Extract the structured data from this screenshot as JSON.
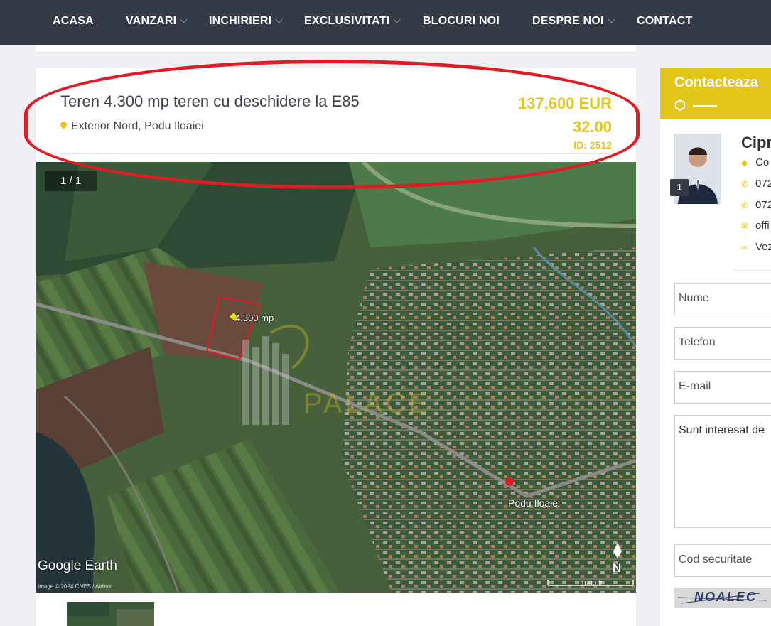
{
  "nav": {
    "items": [
      {
        "label": "ACASA",
        "has_dropdown": false
      },
      {
        "label": "VANZARI",
        "has_dropdown": true
      },
      {
        "label": "INCHIRIERI",
        "has_dropdown": true
      },
      {
        "label": "EXCLUSIVITATI",
        "has_dropdown": true
      },
      {
        "label": "BLOCURI NOI",
        "has_dropdown": false
      },
      {
        "label": "DESPRE NOI",
        "has_dropdown": true
      },
      {
        "label": "CONTACT",
        "has_dropdown": false
      }
    ]
  },
  "listing": {
    "title": "Teren 4.300 mp teren cu deschidere la E85",
    "location": "Exterior Nord, Podu Iloaiei",
    "price": "137,600 EUR",
    "price_per_sqm": "32.00",
    "id_label": "ID: 2512"
  },
  "gallery": {
    "counter": "1 / 1",
    "map_label_area": "4.300 mp",
    "map_label_town": "Podu Iloaiei",
    "watermark": "PALACE",
    "google_earth": "Google Earth",
    "attribution": "Image © 2024 CNES / Airbus",
    "scale": "1000 ft",
    "north": "N"
  },
  "sidebar": {
    "title": "Contacteaza",
    "agent_name": "Cipr",
    "agent_badge": "1",
    "info": [
      {
        "icon": "tag-icon",
        "text": "Co"
      },
      {
        "icon": "phone-icon",
        "text": "072"
      },
      {
        "icon": "phone-icon",
        "text": "072"
      },
      {
        "icon": "envelope-icon",
        "text": "offi"
      },
      {
        "icon": "link-icon",
        "text": "Vez"
      }
    ],
    "form": {
      "name_placeholder": "Nume",
      "phone_placeholder": "Telefon",
      "email_placeholder": "E-mail",
      "message_value": "Sunt interesat de",
      "code_placeholder": "Cod securitate",
      "captcha_text": "NOALEC"
    }
  },
  "colors": {
    "nav_bg": "#343a46",
    "accent_yellow": "#e3c61a",
    "highlight_red": "#e01b24",
    "page_bg": "#eef0f3"
  }
}
